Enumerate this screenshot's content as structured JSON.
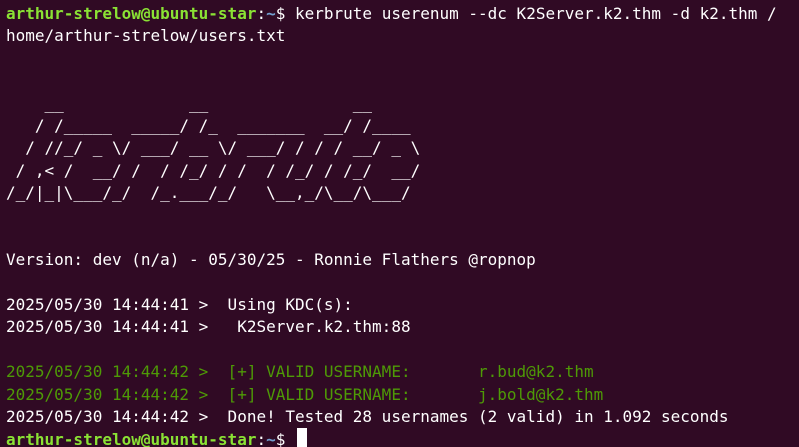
{
  "terminal": {
    "background": "#300a24",
    "prompt_color": "#8ae234",
    "path_color": "#729fcf",
    "valid_color": "#4e9a06",
    "command_line": {
      "user_host": "arthur-strelow@ubuntu-star",
      "colon": ":",
      "path": "~",
      "dollar": "$ ",
      "command_part1": "kerbrute userenum --dc K2Server.k2.thm -d k2.thm /",
      "command_part2": "home/arthur-strelow/users.txt"
    },
    "banner": [
      "    __             __               __     ",
      "   / /_____  _____/ /_  _______  __/ /____ ",
      "  / //_/ _ \\/ ___/ __ \\/ ___/ / / / __/ _ \\",
      " / ,< /  __/ /  / /_/ / /  / /_/ / /_/  __/",
      "/_/|_|\\___/_/  /_.___/_/   \\__,_/\\__/\\___/ "
    ],
    "version_line": "Version: dev (n/a) - 05/30/25 - Ronnie Flathers @ropnop",
    "log_lines": [
      {
        "text": "2025/05/30 14:44:41 >  Using KDC(s):",
        "valid": false
      },
      {
        "text": "2025/05/30 14:44:41 >   K2Server.k2.thm:88",
        "valid": false
      }
    ],
    "result_lines": [
      {
        "text": "2025/05/30 14:44:42 >  [+] VALID USERNAME:       r.bud@k2.thm",
        "valid": true
      },
      {
        "text": "2025/05/30 14:44:42 >  [+] VALID USERNAME:       j.bold@k2.thm",
        "valid": true
      },
      {
        "text": "2025/05/30 14:44:42 >  Done! Tested 28 usernames (2 valid) in 1.092 seconds",
        "valid": false
      }
    ],
    "final_prompt": {
      "user_host": "arthur-strelow@ubuntu-star",
      "colon": ":",
      "path": "~",
      "dollar": "$ "
    }
  }
}
